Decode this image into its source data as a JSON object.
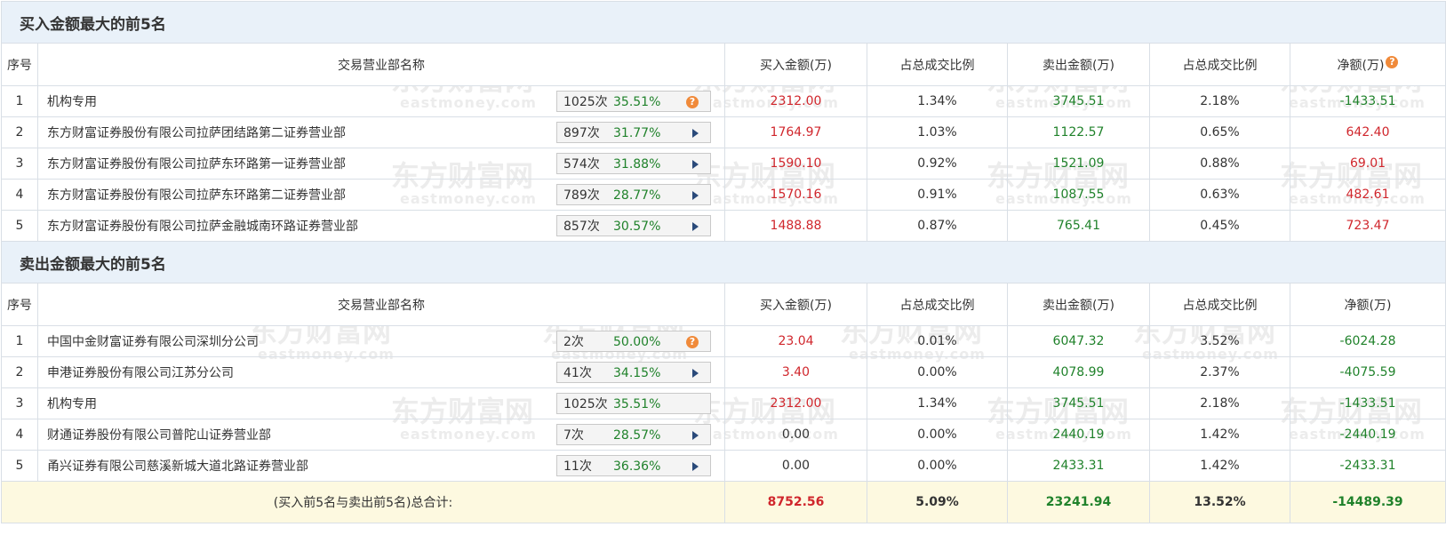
{
  "watermark": {
    "cn": "东方财富网",
    "en": "eastmoney.com"
  },
  "buy_section": {
    "title": "买入金额最大的前5名",
    "headers": {
      "rank": "序号",
      "name": "交易营业部名称",
      "buy": "买入金额(万)",
      "buy_ratio": "占总成交比例",
      "sell": "卖出金额(万)",
      "sell_ratio": "占总成交比例",
      "net": "净额(万)"
    },
    "rows": [
      {
        "rank": "1",
        "name": "机构专用",
        "count": "1025次",
        "pct": "35.51%",
        "icon": "question-icon",
        "buy": "2312.00",
        "buy_ratio": "1.34%",
        "sell": "3745.51",
        "sell_ratio": "2.18%",
        "net": "-1433.51",
        "net_color": "green"
      },
      {
        "rank": "2",
        "name": "东方财富证券股份有限公司拉萨团结路第二证券营业部",
        "count": "897次",
        "pct": "31.77%",
        "icon": "arrow-right-icon",
        "buy": "1764.97",
        "buy_ratio": "1.03%",
        "sell": "1122.57",
        "sell_ratio": "0.65%",
        "net": "642.40",
        "net_color": "red"
      },
      {
        "rank": "3",
        "name": "东方财富证券股份有限公司拉萨东环路第一证券营业部",
        "count": "574次",
        "pct": "31.88%",
        "icon": "arrow-right-icon",
        "buy": "1590.10",
        "buy_ratio": "0.92%",
        "sell": "1521.09",
        "sell_ratio": "0.88%",
        "net": "69.01",
        "net_color": "red"
      },
      {
        "rank": "4",
        "name": "东方财富证券股份有限公司拉萨东环路第二证券营业部",
        "count": "789次",
        "pct": "28.77%",
        "icon": "arrow-right-icon",
        "buy": "1570.16",
        "buy_ratio": "0.91%",
        "sell": "1087.55",
        "sell_ratio": "0.63%",
        "net": "482.61",
        "net_color": "red"
      },
      {
        "rank": "5",
        "name": "东方财富证券股份有限公司拉萨金融城南环路证券营业部",
        "count": "857次",
        "pct": "30.57%",
        "icon": "arrow-right-icon",
        "buy": "1488.88",
        "buy_ratio": "0.87%",
        "sell": "765.41",
        "sell_ratio": "0.45%",
        "net": "723.47",
        "net_color": "red"
      }
    ]
  },
  "sell_section": {
    "title": "卖出金额最大的前5名",
    "headers": {
      "rank": "序号",
      "name": "交易营业部名称",
      "buy": "买入金额(万)",
      "buy_ratio": "占总成交比例",
      "sell": "卖出金额(万)",
      "sell_ratio": "占总成交比例",
      "net": "净额(万)"
    },
    "rows": [
      {
        "rank": "1",
        "name": "中国中金财富证券有限公司深圳分公司",
        "count": "2次",
        "pct": "50.00%",
        "icon": "question-icon",
        "buy": "23.04",
        "buy_ratio": "0.01%",
        "sell": "6047.32",
        "sell_ratio": "3.52%",
        "net": "-6024.28",
        "net_color": "green",
        "buy_color": "red"
      },
      {
        "rank": "2",
        "name": "申港证券股份有限公司江苏分公司",
        "count": "41次",
        "pct": "34.15%",
        "icon": "arrow-right-icon",
        "buy": "3.40",
        "buy_ratio": "0.00%",
        "sell": "4078.99",
        "sell_ratio": "2.37%",
        "net": "-4075.59",
        "net_color": "green",
        "buy_color": "red"
      },
      {
        "rank": "3",
        "name": "机构专用",
        "count": "1025次",
        "pct": "35.51%",
        "icon": "none",
        "buy": "2312.00",
        "buy_ratio": "1.34%",
        "sell": "3745.51",
        "sell_ratio": "2.18%",
        "net": "-1433.51",
        "net_color": "green",
        "buy_color": "red"
      },
      {
        "rank": "4",
        "name": "财通证券股份有限公司普陀山证券营业部",
        "count": "7次",
        "pct": "28.57%",
        "icon": "arrow-right-icon",
        "buy": "0.00",
        "buy_ratio": "0.00%",
        "sell": "2440.19",
        "sell_ratio": "1.42%",
        "net": "-2440.19",
        "net_color": "green",
        "buy_color": "dark"
      },
      {
        "rank": "5",
        "name": "甬兴证券有限公司慈溪新城大道北路证券营业部",
        "count": "11次",
        "pct": "36.36%",
        "icon": "arrow-right-icon",
        "buy": "0.00",
        "buy_ratio": "0.00%",
        "sell": "2433.31",
        "sell_ratio": "1.42%",
        "net": "-2433.31",
        "net_color": "green",
        "buy_color": "dark"
      }
    ]
  },
  "total": {
    "label": "(买入前5名与卖出前5名)总合计:",
    "buy": "8752.56",
    "buy_ratio": "5.09%",
    "sell": "23241.94",
    "sell_ratio": "13.52%",
    "net": "-14489.39"
  },
  "colors": {
    "red": "#d0262c",
    "green": "#20822b",
    "section_bg": "#e9f1f9",
    "total_bg": "#fdf9e0",
    "border": "#d9dfe6",
    "help_icon": "#f08a3a"
  }
}
